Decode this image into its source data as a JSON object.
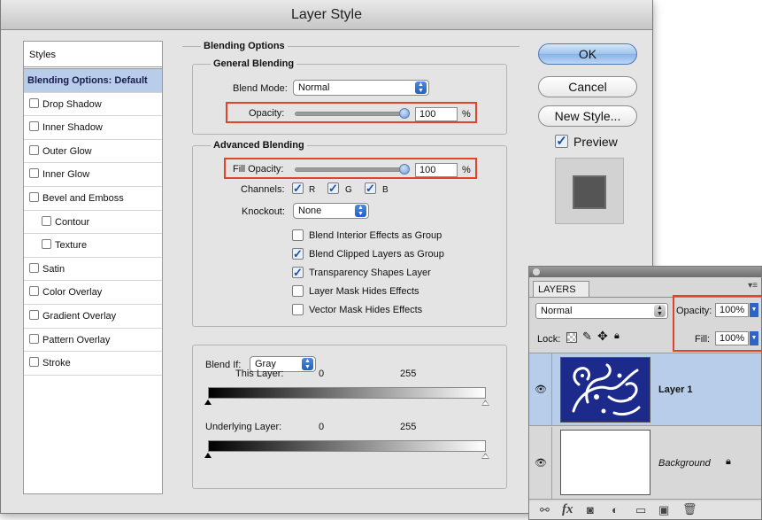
{
  "dialog": {
    "title": "Layer Style",
    "styles_header": "Styles",
    "style_items": [
      {
        "label": "Blending Options: Default",
        "active": true,
        "checkbox": false,
        "indent": false
      },
      {
        "label": "Drop Shadow",
        "active": false,
        "checkbox": true,
        "indent": false
      },
      {
        "label": "Inner Shadow",
        "active": false,
        "checkbox": true,
        "indent": false
      },
      {
        "label": "Outer Glow",
        "active": false,
        "checkbox": true,
        "indent": false
      },
      {
        "label": "Inner Glow",
        "active": false,
        "checkbox": true,
        "indent": false
      },
      {
        "label": "Bevel and Emboss",
        "active": false,
        "checkbox": true,
        "indent": false
      },
      {
        "label": "Contour",
        "active": false,
        "checkbox": true,
        "indent": true
      },
      {
        "label": "Texture",
        "active": false,
        "checkbox": true,
        "indent": true
      },
      {
        "label": "Satin",
        "active": false,
        "checkbox": true,
        "indent": false
      },
      {
        "label": "Color Overlay",
        "active": false,
        "checkbox": true,
        "indent": false
      },
      {
        "label": "Gradient Overlay",
        "active": false,
        "checkbox": true,
        "indent": false
      },
      {
        "label": "Pattern Overlay",
        "active": false,
        "checkbox": true,
        "indent": false
      },
      {
        "label": "Stroke",
        "active": false,
        "checkbox": true,
        "indent": false
      }
    ],
    "blending_options": {
      "legend": "Blending Options",
      "general_legend": "General Blending",
      "blend_mode_label": "Blend Mode:",
      "blend_mode_value": "Normal",
      "opacity_label": "Opacity:",
      "opacity_value": "100",
      "opacity_fraction": 1.0,
      "percent": "%"
    },
    "advanced": {
      "legend": "Advanced Blending",
      "fill_opacity_label": "Fill Opacity:",
      "fill_opacity_value": "100",
      "fill_opacity_fraction": 1.0,
      "percent": "%",
      "channels_label": "Channels:",
      "channels": [
        {
          "label": "R",
          "checked": true
        },
        {
          "label": "G",
          "checked": true
        },
        {
          "label": "B",
          "checked": true
        }
      ],
      "knockout_label": "Knockout:",
      "knockout_value": "None",
      "options": [
        {
          "label": "Blend Interior Effects as Group",
          "checked": false
        },
        {
          "label": "Blend Clipped Layers as Group",
          "checked": true
        },
        {
          "label": "Transparency Shapes Layer",
          "checked": true
        },
        {
          "label": "Layer Mask Hides Effects",
          "checked": false
        },
        {
          "label": "Vector Mask Hides Effects",
          "checked": false
        }
      ]
    },
    "blend_if": {
      "label": "Blend If:",
      "value": "Gray",
      "this_layer_label": "This Layer:",
      "this_layer_min": "0",
      "this_layer_max": "255",
      "underlying_label": "Underlying Layer:",
      "underlying_min": "0",
      "underlying_max": "255"
    },
    "buttons": {
      "ok": "OK",
      "cancel": "Cancel",
      "new_style": "New Style...",
      "preview": "Preview",
      "preview_checked": true
    }
  },
  "layers_panel": {
    "tab": "LAYERS",
    "blend_mode": "Normal",
    "opacity_label": "Opacity:",
    "opacity_value": "100%",
    "lock_label": "Lock:",
    "fill_label": "Fill:",
    "fill_value": "100%",
    "layers": [
      {
        "name": "Layer 1",
        "selected": true,
        "visible": true,
        "locked": false
      },
      {
        "name": "Background",
        "selected": false,
        "visible": true,
        "locked": true
      }
    ],
    "footer_icons": [
      "link-icon",
      "fx-icon",
      "mask-icon",
      "adjustment-icon",
      "folder-icon",
      "new-layer-icon",
      "trash-icon"
    ],
    "footer_fx": "fx"
  },
  "colors": {
    "highlight": "#e0452b",
    "selection": "#b7cdea",
    "layer_thumb": "#1c2a8c"
  }
}
